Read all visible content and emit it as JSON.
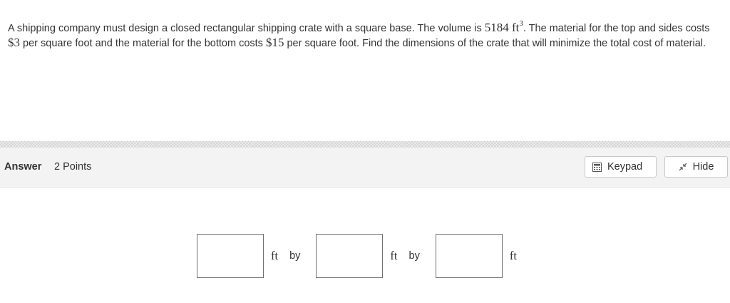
{
  "question": {
    "part1": "A shipping company must design a closed rectangular shipping crate with a square base. The volume is ",
    "volume_value": "5184",
    "volume_unit": "ft",
    "volume_exp": "3",
    "part2": ". The material for the top and sides costs ",
    "top_sides_cost": "$3",
    "part3": " per square foot and the material for the bottom costs ",
    "bottom_cost": "$15",
    "part4": " per square foot. Find the dimensions of the crate that will minimize the total cost of material."
  },
  "answer_bar": {
    "label": "Answer",
    "points": "2 Points",
    "keypad_label": "Keypad",
    "hide_label": "Hide",
    "keypad_icon": "calculator-icon",
    "hide_icon": "collapse-arrows-icon"
  },
  "answer_row": {
    "inputs": [
      {
        "value": "",
        "placeholder": ""
      },
      {
        "value": "",
        "placeholder": ""
      },
      {
        "value": "",
        "placeholder": ""
      }
    ],
    "unit": "ft",
    "by": "by"
  },
  "colors": {
    "text": "#333333",
    "answer_bar_bg": "#f3f3f3",
    "input_border": "#6f6f6f"
  }
}
